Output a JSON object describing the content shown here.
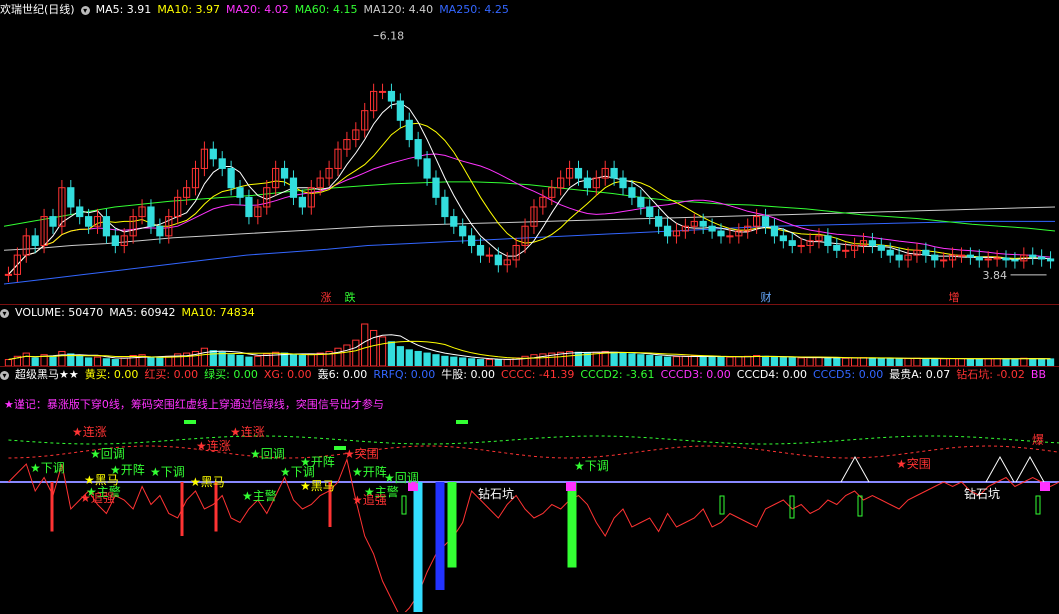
{
  "price_header": {
    "stock": "欢瑞世纪(日线)",
    "items": [
      {
        "label": "MA5: 3.91",
        "color": "#ffffff"
      },
      {
        "label": "MA10: 3.97",
        "color": "#ffff00"
      },
      {
        "label": "MA20: 4.02",
        "color": "#ff33ff"
      },
      {
        "label": "MA60: 4.15",
        "color": "#33ff33"
      },
      {
        "label": "MA120: 4.40",
        "color": "#cccccc"
      },
      {
        "label": "MA250: 4.25",
        "color": "#3366ff"
      }
    ]
  },
  "price_annotations": {
    "high": "6.18",
    "low": "3.84"
  },
  "event_markers": [
    {
      "text": "涨",
      "color": "#ff3333"
    },
    {
      "text": "跌",
      "color": "#33ff33"
    },
    {
      "text": "财",
      "color": "#66aaff"
    },
    {
      "text": "增",
      "color": "#ff3333"
    }
  ],
  "volume_header": {
    "items": [
      {
        "label": "VOLUME: 50470",
        "color": "#ffffff"
      },
      {
        "label": "MA5: 60942",
        "color": "#ffffff"
      },
      {
        "label": "MA10: 74834",
        "color": "#ffff00"
      }
    ]
  },
  "indicator_header": {
    "items": [
      {
        "label": "超级黑马★★",
        "color": "#ffffff"
      },
      {
        "label": "黄买: 0.00",
        "color": "#ffff00"
      },
      {
        "label": "红买: 0.00",
        "color": "#ff3333"
      },
      {
        "label": "绿买: 0.00",
        "color": "#33ff33"
      },
      {
        "label": "XG: 0.00",
        "color": "#ff3333"
      },
      {
        "label": "轰6: 0.00",
        "color": "#ffffff"
      },
      {
        "label": "RRFQ: 0.00",
        "color": "#3366ff"
      },
      {
        "label": "牛股: 0.00",
        "color": "#ffffff"
      },
      {
        "label": "CCCC: -41.39",
        "color": "#ff3333"
      },
      {
        "label": "CCCD2: -3.61",
        "color": "#33ff33"
      },
      {
        "label": "CCCD3: 0.00",
        "color": "#ff33ff"
      },
      {
        "label": "CCCD4: 0.00",
        "color": "#ffffff"
      },
      {
        "label": "CCCD5: 0.00",
        "color": "#3366ff"
      },
      {
        "label": "最贵A: 0.07",
        "color": "#ffffff"
      },
      {
        "label": "钻石坑: -0.02",
        "color": "#ff3333"
      },
      {
        "label": "BB",
        "color": "#ff33ff"
      }
    ],
    "note": "★谨记：暴涨版下穿0线，筹码突围红虚线上穿通过信绿线，突围信号出才参与"
  },
  "indicator_labels": [
    {
      "text": "连涨",
      "color": "#ff3333"
    },
    {
      "text": "连涨",
      "color": "#ff3333"
    },
    {
      "text": "连涨",
      "color": "#ff3333"
    },
    {
      "text": "回调",
      "color": "#33ff33"
    },
    {
      "text": "回调",
      "color": "#33ff33"
    },
    {
      "text": "回调",
      "color": "#33ff33"
    },
    {
      "text": "下调",
      "color": "#33ff33"
    },
    {
      "text": "下调",
      "color": "#33ff33"
    },
    {
      "text": "下调",
      "color": "#33ff33"
    },
    {
      "text": "下调",
      "color": "#33ff33"
    },
    {
      "text": "开阵",
      "color": "#33ff33"
    },
    {
      "text": "开阵",
      "color": "#33ff33"
    },
    {
      "text": "开阵",
      "color": "#33ff33"
    },
    {
      "text": "突围",
      "color": "#ff3333"
    },
    {
      "text": "突围",
      "color": "#ff3333"
    },
    {
      "text": "黑马",
      "color": "#ffff00"
    },
    {
      "text": "黑马",
      "color": "#ffff00"
    },
    {
      "text": "黑马",
      "color": "#ffff00"
    },
    {
      "text": "主警",
      "color": "#33ff33"
    },
    {
      "text": "主警",
      "color": "#33ff33"
    },
    {
      "text": "主警",
      "color": "#33ff33"
    },
    {
      "text": "追强",
      "color": "#ff3333"
    },
    {
      "text": "追强",
      "color": "#ff3333"
    },
    {
      "text": "钻石坑",
      "color": "#ffffff"
    },
    {
      "text": "钻石坑",
      "color": "#ffffff"
    },
    {
      "text": "爆",
      "color": "#ff3333"
    }
  ],
  "chart_data": {
    "type": "candlestick",
    "close": [
      3.7,
      3.9,
      4.1,
      4.0,
      4.3,
      4.2,
      4.6,
      4.4,
      4.3,
      4.2,
      4.3,
      4.1,
      4.0,
      4.1,
      4.3,
      4.4,
      4.2,
      4.1,
      4.3,
      4.5,
      4.6,
      4.8,
      5.0,
      4.9,
      4.8,
      4.6,
      4.5,
      4.3,
      4.4,
      4.6,
      4.8,
      4.7,
      4.5,
      4.4,
      4.6,
      4.7,
      4.8,
      5.0,
      5.1,
      5.2,
      5.4,
      5.6,
      5.6,
      5.5,
      5.3,
      5.1,
      4.9,
      4.7,
      4.5,
      4.3,
      4.2,
      4.1,
      4.0,
      3.9,
      3.9,
      3.8,
      3.85,
      4.0,
      4.2,
      4.4,
      4.5,
      4.6,
      4.7,
      4.8,
      4.7,
      4.6,
      4.7,
      4.8,
      4.7,
      4.6,
      4.5,
      4.4,
      4.3,
      4.2,
      4.1,
      4.15,
      4.2,
      4.25,
      4.2,
      4.15,
      4.1,
      4.1,
      4.15,
      4.2,
      4.3,
      4.2,
      4.1,
      4.05,
      4.0,
      4.0,
      4.05,
      4.1,
      4.0,
      3.95,
      3.95,
      4.0,
      4.05,
      4.0,
      3.95,
      3.9,
      3.85,
      3.9,
      3.95,
      3.9,
      3.85,
      3.85,
      3.9,
      3.9,
      3.88,
      3.85,
      3.86,
      3.87,
      3.85,
      3.84,
      3.9,
      3.88,
      3.86,
      3.84
    ],
    "ma_series": [
      {
        "name": "MA60",
        "values": [
          4.2,
          4.25,
          4.3,
          4.35,
          4.4,
          4.43,
          4.46,
          4.48,
          4.5,
          4.52,
          4.55,
          4.58,
          4.6,
          4.62,
          4.64,
          4.65,
          4.66,
          4.66,
          4.65,
          4.63,
          4.6,
          4.57,
          4.54,
          4.5,
          4.47,
          4.45,
          4.43,
          4.42,
          4.4,
          4.38,
          4.35,
          4.32,
          4.3,
          4.28,
          4.25,
          4.22,
          4.2,
          4.18,
          4.15
        ]
      },
      {
        "name": "MA120",
        "values": [
          3.95,
          3.97,
          4.0,
          4.02,
          4.05,
          4.08,
          4.1,
          4.12,
          4.14,
          4.16,
          4.18,
          4.2,
          4.21,
          4.22,
          4.23,
          4.24,
          4.25,
          4.26,
          4.27,
          4.28,
          4.29,
          4.3,
          4.31,
          4.32,
          4.33,
          4.34,
          4.35,
          4.36,
          4.37,
          4.38,
          4.39,
          4.4
        ]
      },
      {
        "name": "MA250",
        "values": [
          3.6,
          3.65,
          3.7,
          3.75,
          3.8,
          3.85,
          3.9,
          3.93,
          3.96,
          4.0,
          4.02,
          4.04,
          4.06,
          4.08,
          4.1,
          4.12,
          4.14,
          4.16,
          4.18,
          4.2,
          4.21,
          4.22,
          4.23,
          4.24,
          4.25,
          4.25,
          4.25
        ]
      }
    ],
    "volume": [
      40,
      60,
      80,
      50,
      70,
      55,
      90,
      75,
      60,
      50,
      55,
      45,
      40,
      50,
      65,
      70,
      55,
      50,
      60,
      75,
      80,
      90,
      110,
      95,
      85,
      70,
      65,
      55,
      60,
      75,
      85,
      80,
      70,
      65,
      75,
      80,
      90,
      110,
      130,
      160,
      260,
      220,
      180,
      150,
      120,
      100,
      90,
      80,
      70,
      60,
      55,
      50,
      45,
      40,
      40,
      38,
      40,
      50,
      60,
      70,
      75,
      80,
      85,
      90,
      85,
      80,
      85,
      90,
      85,
      80,
      75,
      70,
      65,
      60,
      55,
      58,
      60,
      62,
      60,
      58,
      55,
      55,
      58,
      60,
      65,
      60,
      55,
      52,
      50,
      50,
      52,
      55,
      50,
      48,
      48,
      50,
      52,
      50,
      48,
      46,
      45,
      46,
      48,
      46,
      45,
      45,
      46,
      46,
      45,
      44,
      45,
      46,
      45,
      44,
      48,
      46,
      45,
      44
    ],
    "indicator_line": [
      0,
      10,
      20,
      -10,
      5,
      -15,
      20,
      -30,
      -20,
      -10,
      -25,
      -35,
      -15,
      -20,
      -30,
      -5,
      -25,
      -15,
      -35,
      -40,
      -20,
      -10,
      -30,
      -25,
      -15,
      -40,
      -45,
      -30,
      -20,
      -35,
      -15,
      5,
      -20,
      -30,
      -25,
      -15,
      -10,
      0,
      25,
      -20,
      -60,
      -80,
      -110,
      -130,
      -150,
      -140,
      -125,
      -100,
      -80,
      -70,
      -60,
      -45,
      -10,
      -20,
      -30,
      -40,
      -25,
      -15,
      -30,
      -40,
      -35,
      -25,
      -30,
      -20,
      -15,
      -25,
      -45,
      -60,
      -40,
      -30,
      -50,
      -45,
      -40,
      -55,
      -35,
      -50,
      -45,
      -40,
      -30,
      -50,
      -45,
      -35,
      -40,
      -45,
      -50,
      -30,
      -25,
      -20,
      -30,
      -25,
      -35,
      -30,
      -20,
      -25,
      -15,
      -10,
      -20,
      -15,
      -20,
      -25,
      -30,
      -20,
      -15,
      -10,
      -5,
      0,
      -5,
      0,
      -10,
      -15,
      -5,
      0,
      5,
      -5,
      0,
      5,
      0,
      -5,
      0
    ],
    "ylim": [
      3.6,
      6.3
    ]
  }
}
